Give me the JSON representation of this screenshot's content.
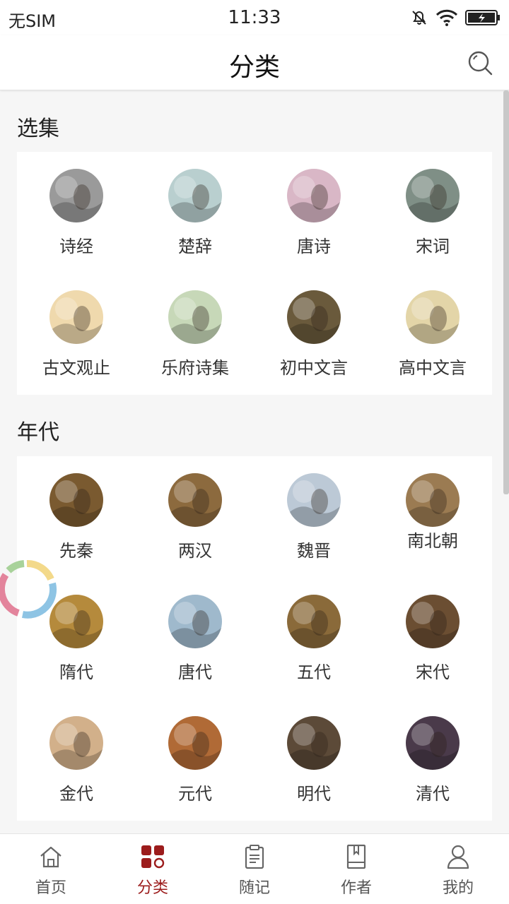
{
  "status_bar": {
    "carrier": "无SIM",
    "time": "11:33"
  },
  "nav": {
    "title": "分类"
  },
  "sections": [
    {
      "title": "选集",
      "items": [
        {
          "label": "诗经",
          "icon": "ink-landscape-thumbnail",
          "tint": "#9a9a9a"
        },
        {
          "label": "楚辞",
          "icon": "mountain-landscape-thumbnail",
          "tint": "#b9cfcf"
        },
        {
          "label": "唐诗",
          "icon": "lady-umbrella-thumbnail",
          "tint": "#d9b7c6"
        },
        {
          "label": "宋词",
          "icon": "misty-mountain-thumbnail",
          "tint": "#7f8f86"
        },
        {
          "label": "古文观止",
          "icon": "calligraphy-scholar-thumbnail",
          "tint": "#efd9ad"
        },
        {
          "label": "乐府诗集",
          "icon": "flower-calligraphy-thumbnail",
          "tint": "#c7d8b8"
        },
        {
          "label": "初中文言",
          "icon": "confucius-portrait-thumbnail",
          "tint": "#6a5a3c"
        },
        {
          "label": "高中文言",
          "icon": "scroll-painting-thumbnail",
          "tint": "#e3d5a8"
        }
      ]
    },
    {
      "title": "年代",
      "items": [
        {
          "label": "先秦",
          "icon": "bronze-dragon-thumbnail",
          "tint": "#7a5a30"
        },
        {
          "label": "两汉",
          "icon": "stone-relief-thumbnail",
          "tint": "#8c6a3e"
        },
        {
          "label": "魏晋",
          "icon": "beauty-portrait-thumbnail",
          "tint": "#bcc9d6"
        },
        {
          "label": "南北朝",
          "icon": "seated-scholar-thumbnail",
          "tint": "#9b7b52",
          "raised": true
        },
        {
          "label": "隋代",
          "icon": "emperor-portrait-thumbnail",
          "tint": "#b58a3c"
        },
        {
          "label": "唐代",
          "icon": "reclining-poet-thumbnail",
          "tint": "#9fb9cc"
        },
        {
          "label": "五代",
          "icon": "birds-painting-thumbnail",
          "tint": "#8a6a3a"
        },
        {
          "label": "宋代",
          "icon": "pavilion-painting-thumbnail",
          "tint": "#6b4e32"
        },
        {
          "label": "金代",
          "icon": "gilt-beast-thumbnail",
          "tint": "#d2b08a"
        },
        {
          "label": "元代",
          "icon": "mural-figures-thumbnail",
          "tint": "#b06a36"
        },
        {
          "label": "明代",
          "icon": "ming-official-thumbnail",
          "tint": "#5c4a38"
        },
        {
          "label": "清代",
          "icon": "qing-official-thumbnail",
          "tint": "#4a3a4a"
        }
      ]
    }
  ],
  "tabs": [
    {
      "label": "首页",
      "icon": "home-icon",
      "active": false
    },
    {
      "label": "分类",
      "icon": "category-grid-icon",
      "active": true
    },
    {
      "label": "随记",
      "icon": "clipboard-note-icon",
      "active": false
    },
    {
      "label": "作者",
      "icon": "book-icon",
      "active": false
    },
    {
      "label": "我的",
      "icon": "person-icon",
      "active": false
    }
  ],
  "colors": {
    "accent": "#9c1c1c",
    "background": "#f6f6f6",
    "card": "#ffffff"
  }
}
